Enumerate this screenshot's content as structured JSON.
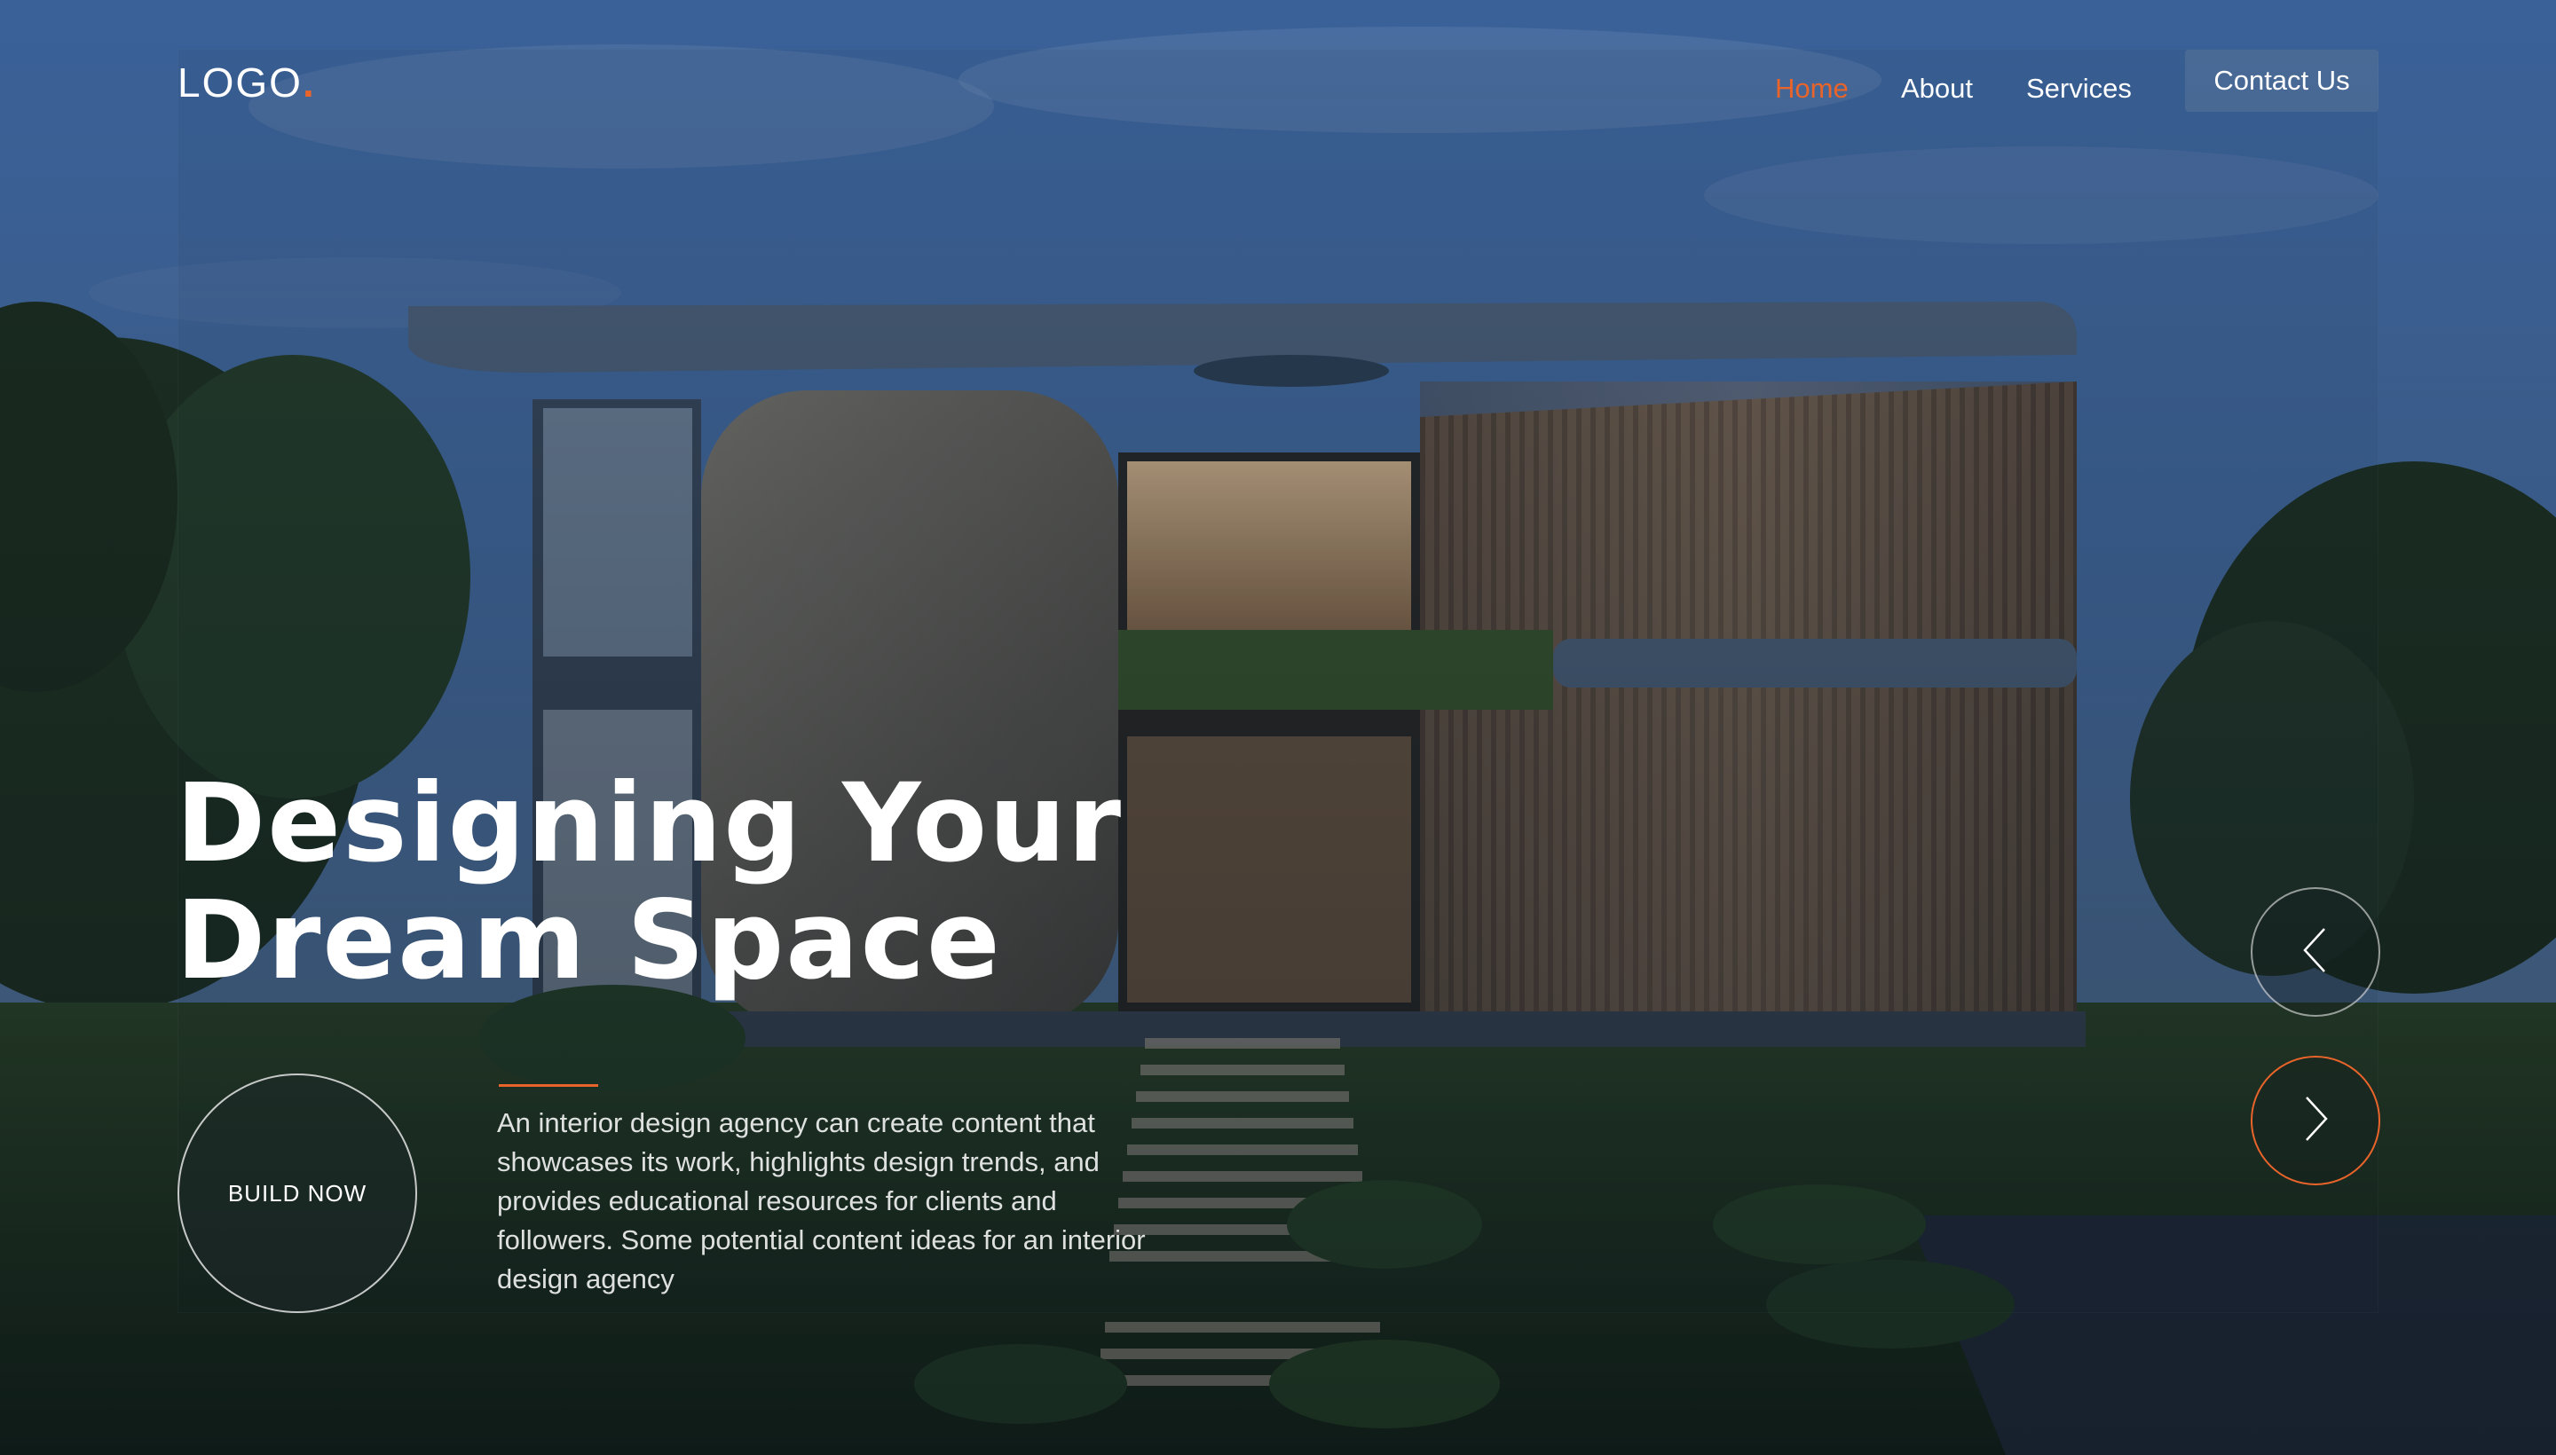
{
  "brand": {
    "logo_text": "LOGO",
    "logo_dot": ".",
    "accent_color": "#e8642a"
  },
  "nav": {
    "items": [
      {
        "label": "Home",
        "active": true
      },
      {
        "label": "About",
        "active": false
      },
      {
        "label": "Services",
        "active": false
      }
    ],
    "contact_label": "Contact Us"
  },
  "hero": {
    "title_line1": "Designing Your",
    "title_line2": "Dream Space",
    "description": "An interior design agency can create content that showcases its work, highlights design trends, and provides educational resources for clients and followers. Some potential content ideas for an interior design agency",
    "cta_label": "BUILD NOW"
  },
  "slider": {
    "prev_icon": "chevron-left-icon",
    "next_icon": "chevron-right-icon"
  }
}
